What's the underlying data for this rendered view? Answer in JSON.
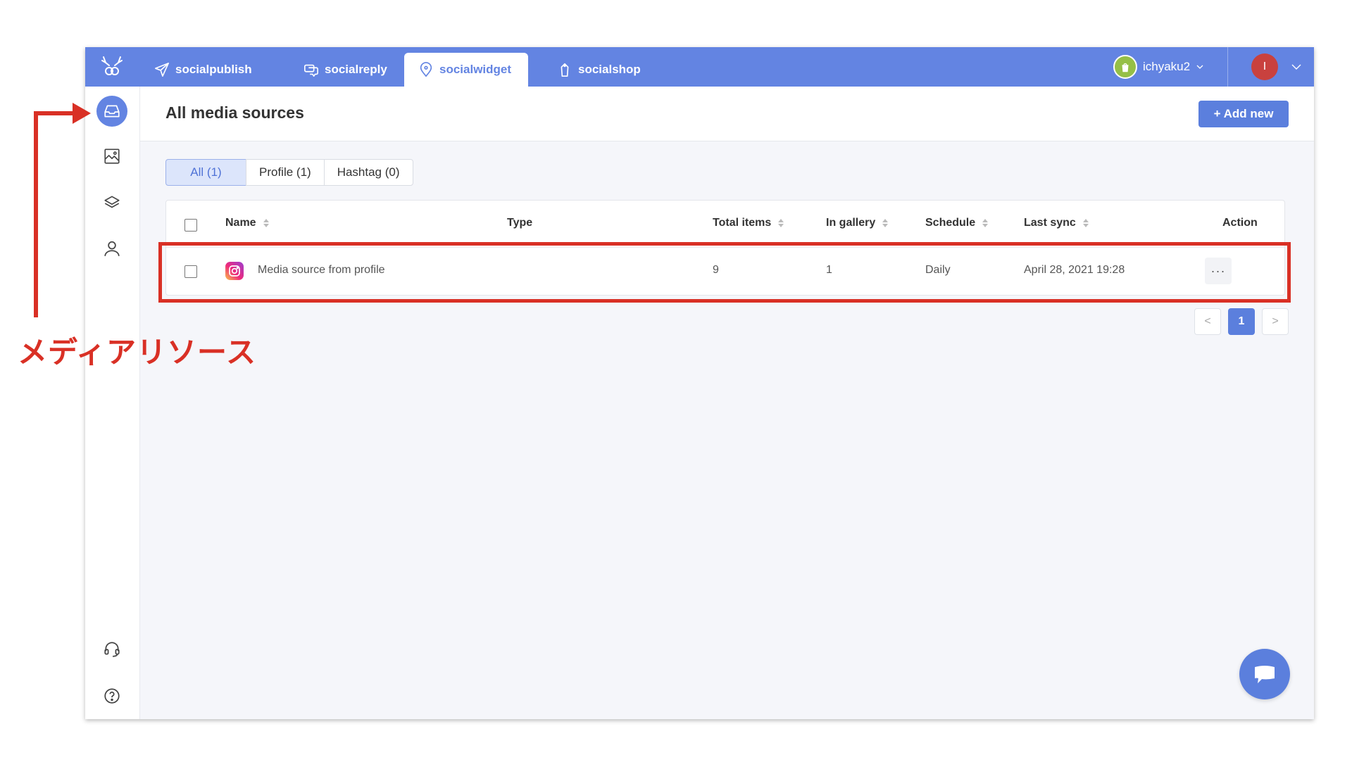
{
  "topbar": {
    "nav": [
      {
        "label": "socialpublish",
        "icon": "paper-plane-icon"
      },
      {
        "label": "socialreply",
        "icon": "chat-bubbles-icon"
      },
      {
        "label": "socialwidget",
        "icon": "location-pin-icon"
      },
      {
        "label": "socialshop",
        "icon": "shopping-bag-icon"
      }
    ],
    "active_nav": "socialwidget",
    "shop_name": "ichyaku2",
    "avatar_initial": "I"
  },
  "sidebar": {
    "items": [
      {
        "icon": "inbox-icon",
        "active": true
      },
      {
        "icon": "image-gallery-icon",
        "active": false
      },
      {
        "icon": "layers-icon",
        "active": false
      },
      {
        "icon": "user-icon",
        "active": false
      },
      {
        "icon": "headset-support-icon",
        "active": false
      },
      {
        "icon": "help-icon",
        "active": false
      }
    ]
  },
  "page": {
    "title": "All media sources",
    "add_button": "+ Add new"
  },
  "filters": [
    {
      "label": "All (1)",
      "active": true
    },
    {
      "label": "Profile (1)",
      "active": false
    },
    {
      "label": "Hashtag (0)",
      "active": false
    }
  ],
  "table": {
    "columns": {
      "name": "Name",
      "type": "Type",
      "total_items": "Total items",
      "in_gallery": "In gallery",
      "schedule": "Schedule",
      "last_sync": "Last sync",
      "action": "Action"
    },
    "rows": [
      {
        "source_icon": "instagram-icon",
        "name": "Media source from profile",
        "type": "",
        "total_items": "9",
        "in_gallery": "1",
        "schedule": "Daily",
        "last_sync": "April 28, 2021 19:28",
        "action": "···"
      }
    ]
  },
  "pagination": {
    "prev": "<",
    "current": "1",
    "next": ">"
  },
  "annotation": {
    "label": "メディアリソース",
    "color": "#d93025"
  },
  "colors": {
    "brand": "#6384e2",
    "button": "#5b7fdd",
    "annotation": "#d93025"
  }
}
